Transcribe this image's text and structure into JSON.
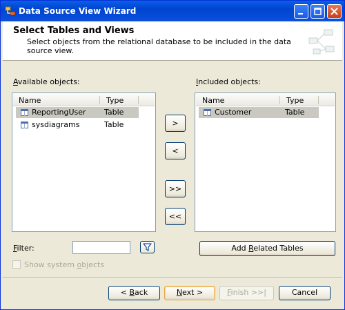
{
  "window": {
    "title": "Data Source View Wizard",
    "controls": [
      "minimize",
      "maximize",
      "close"
    ]
  },
  "header": {
    "title": "Select Tables and Views",
    "description": "Select objects from the relational database to be included in the data source view."
  },
  "available": {
    "label_first": "A",
    "label_rest": "vailable objects:",
    "columns": [
      "Name",
      "Type"
    ],
    "rows": [
      {
        "name": "ReportingUser",
        "type": "Table",
        "selected": true
      },
      {
        "name": "sysdiagrams",
        "type": "Table",
        "selected": false
      }
    ]
  },
  "included": {
    "label_first": "I",
    "label_rest": "ncluded objects:",
    "columns": [
      "Name",
      "Type"
    ],
    "rows": [
      {
        "name": "Customer",
        "type": "Table",
        "selected": true
      }
    ]
  },
  "transfer": {
    "add": ">",
    "remove": "<",
    "add_all": ">>",
    "remove_all": "<<"
  },
  "filter": {
    "label_first": "F",
    "label_rest": "ilter:",
    "value": ""
  },
  "add_related": {
    "label_pre": "Add ",
    "label_underlined": "R",
    "label_post": "elated Tables"
  },
  "show_system": {
    "label_pre": "Show system ",
    "label_underlined": "o",
    "label_post": "bjects",
    "checked": false
  },
  "footer": {
    "back_pre": "< ",
    "back_u": "B",
    "back_post": "ack",
    "next_u": "N",
    "next_post": "ext >",
    "finish_u": "F",
    "finish_post": "inish >>|",
    "cancel": "Cancel"
  },
  "colors": {
    "titlebar": "#0a5fe8",
    "dialog_bg": "#ece9d8",
    "selection": "#c9c8c1",
    "default_button_border": "#e8a740"
  }
}
